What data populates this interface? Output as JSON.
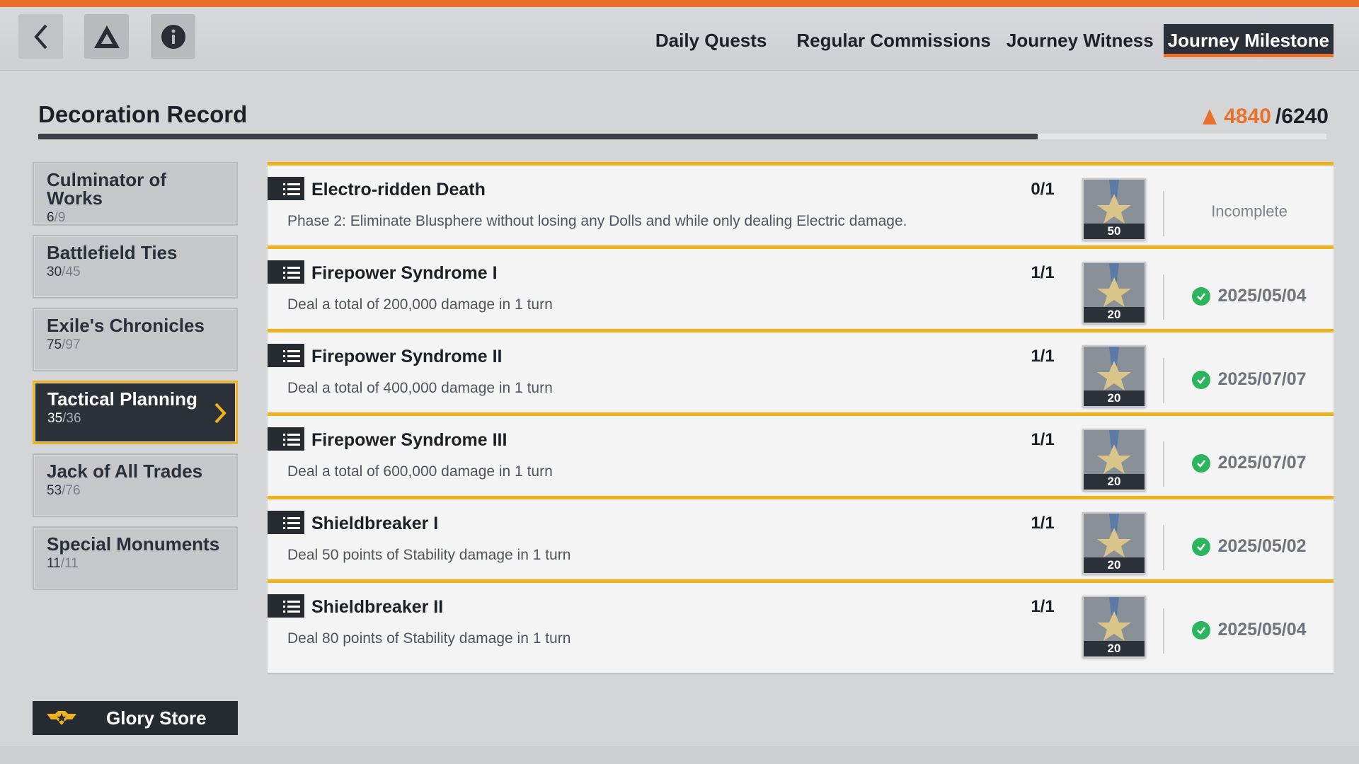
{
  "nav": {
    "tabs": [
      {
        "label": "Daily Quests"
      },
      {
        "label": "Regular Commissions"
      },
      {
        "label": "Journey Witness"
      },
      {
        "label": "Journey Milestone"
      }
    ],
    "active_tab": "Journey Milestone"
  },
  "header": {
    "title": "Decoration Record",
    "score_current": "4840",
    "score_total": "/6240",
    "progress_fraction": 0.776
  },
  "sidebar": {
    "categories": [
      {
        "name": "Culminator of Works",
        "count": "6",
        "total": "/9"
      },
      {
        "name": "Battlefield Ties",
        "count": "30",
        "total": "/45"
      },
      {
        "name": "Exile's Chronicles",
        "count": "75",
        "total": "/97"
      },
      {
        "name": "Tactical Planning",
        "count": "35",
        "total": "/36"
      },
      {
        "name": "Jack of All Trades",
        "count": "53",
        "total": "/76"
      },
      {
        "name": "Special Monuments",
        "count": "11",
        "total": "/11"
      }
    ],
    "active_category": "Tactical Planning",
    "glory_store_label": "Glory Store"
  },
  "quests": [
    {
      "title": "Electro-ridden Death",
      "progress": "0/1",
      "description": "Phase 2: Eliminate Blusphere without losing any Dolls and while only dealing Electric damage.",
      "reward": "50",
      "status": "Incomplete",
      "complete": false
    },
    {
      "title": "Firepower Syndrome I",
      "progress": "1/1",
      "description": "Deal a total of 200,000 damage in 1 turn",
      "reward": "20",
      "status": "2025/05/04",
      "complete": true
    },
    {
      "title": "Firepower Syndrome II",
      "progress": "1/1",
      "description": "Deal a total of 400,000 damage in 1 turn",
      "reward": "20",
      "status": "2025/07/07",
      "complete": true
    },
    {
      "title": "Firepower Syndrome III",
      "progress": "1/1",
      "description": "Deal a total of 600,000 damage in 1 turn",
      "reward": "20",
      "status": "2025/07/07",
      "complete": true
    },
    {
      "title": "Shieldbreaker I",
      "progress": "1/1",
      "description": "Deal 50 points of Stability damage in 1 turn",
      "reward": "20",
      "status": "2025/05/02",
      "complete": true
    },
    {
      "title": "Shieldbreaker II",
      "progress": "1/1",
      "description": "Deal 80 points of Stability damage in 1 turn",
      "reward": "20",
      "status": "2025/05/04",
      "complete": true
    }
  ],
  "colors": {
    "accent_orange": "#e9712b",
    "accent_yellow": "#f0b21a",
    "dark": "#2c3039",
    "complete_green": "#2db55d"
  },
  "icons": [
    "back-arrow-icon",
    "logo-triangle-icon",
    "info-icon",
    "flame-score-icon",
    "list-icon",
    "medal-icon",
    "check-icon",
    "chevron-right-icon",
    "glory-emblem-icon"
  ]
}
